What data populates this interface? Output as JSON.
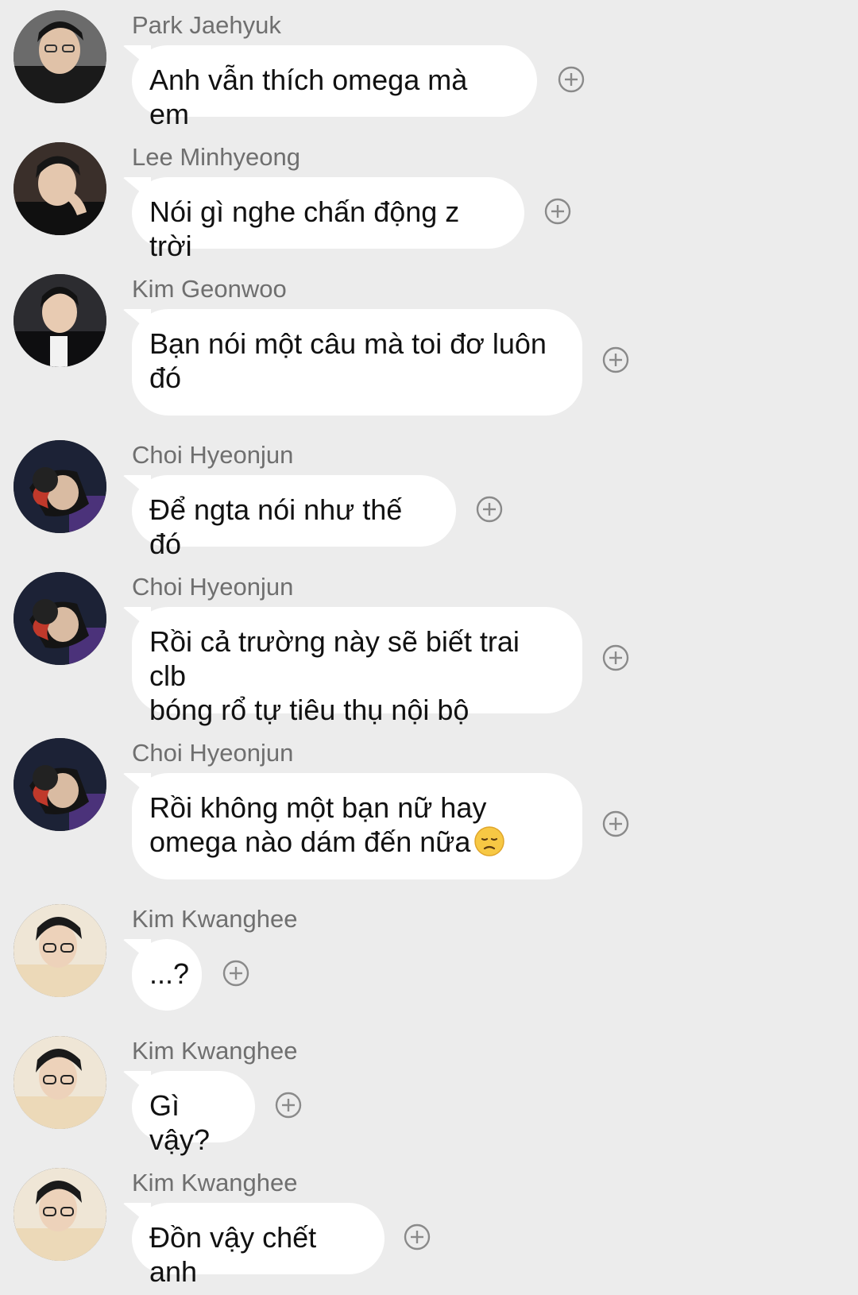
{
  "messages": [
    {
      "sender": "Park Jaehyuk",
      "text": "Anh vẫn thích omega mà em",
      "avatar": "avatar-park-jaehyuk"
    },
    {
      "sender": "Lee Minhyeong",
      "text": "Nói gì nghe chấn động z trời",
      "avatar": "avatar-lee-minhyeong"
    },
    {
      "sender": "Kim Geonwoo",
      "text": "Bạn nói một câu mà toi đơ luôn\nđó",
      "avatar": "avatar-kim-geonwoo"
    },
    {
      "sender": "Choi Hyeonjun",
      "text": "Để ngta nói như thế đó",
      "avatar": "avatar-choi-hyeonjun"
    },
    {
      "sender": "Choi Hyeonjun",
      "text": "Rồi cả trường này sẽ biết trai clb\nbóng rổ tự tiêu thụ nội bộ",
      "avatar": "avatar-choi-hyeonjun"
    },
    {
      "sender": "Choi Hyeonjun",
      "text": "Rồi không một bạn nữ hay\nomega nào dám đến nữa",
      "emoji": "disappointed-face",
      "avatar": "avatar-choi-hyeonjun"
    },
    {
      "sender": "Kim Kwanghee",
      "text": "...?",
      "avatar": "avatar-kim-kwanghee"
    },
    {
      "sender": "Kim Kwanghee",
      "text": "Gì vậy?",
      "avatar": "avatar-kim-kwanghee"
    },
    {
      "sender": "Kim Kwanghee",
      "text": "Đồn vậy chết anh",
      "avatar": "avatar-kim-kwanghee"
    }
  ],
  "icons": {
    "reaction": "plus-circle-icon"
  },
  "colors": {
    "background": "#ececec",
    "bubble": "#ffffff",
    "sender_name": "#6f6f6f",
    "text": "#111111",
    "icon": "#8a8a8a"
  }
}
